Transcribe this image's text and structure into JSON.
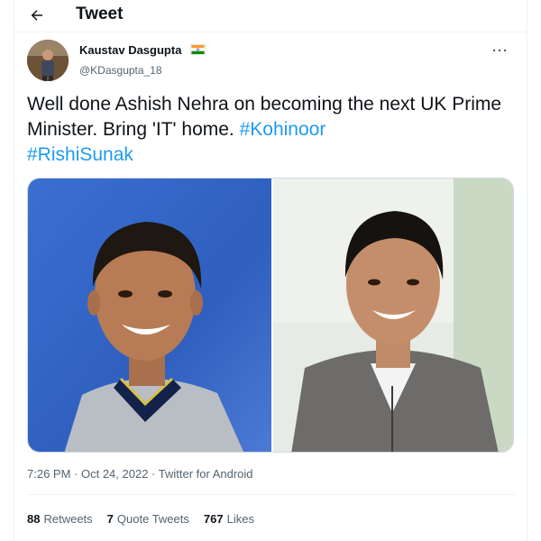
{
  "header": {
    "title": "Tweet",
    "back_icon": "arrow-left-icon"
  },
  "author": {
    "display_name": "Kaustav Dasgupta",
    "handle": "@KDasgupta_18",
    "flag_icon": "india-flag-icon"
  },
  "more_label": "···",
  "tweet": {
    "text_plain": "Well done Ashish Nehra on becoming the next UK Prime Minister. Bring 'IT' home. ",
    "hashtag_1": "#Kohinoor",
    "hashtag_2": "#RishiSunak"
  },
  "media": {
    "left_image": "portrait-man-cricket-jersey",
    "right_image": "portrait-man-grey-sweater"
  },
  "meta": {
    "time": "7:26 PM",
    "separator": " · ",
    "date": "Oct 24, 2022",
    "source": "Twitter for Android"
  },
  "stats": {
    "retweets_count": "88",
    "retweets_label": "Retweets",
    "quotes_count": "7",
    "quotes_label": "Quote Tweets",
    "likes_count": "767",
    "likes_label": "Likes"
  },
  "colors": {
    "accent": "#1d9bf0",
    "text": "#0f1419",
    "secondary": "#536471",
    "border": "#eff3f4"
  }
}
